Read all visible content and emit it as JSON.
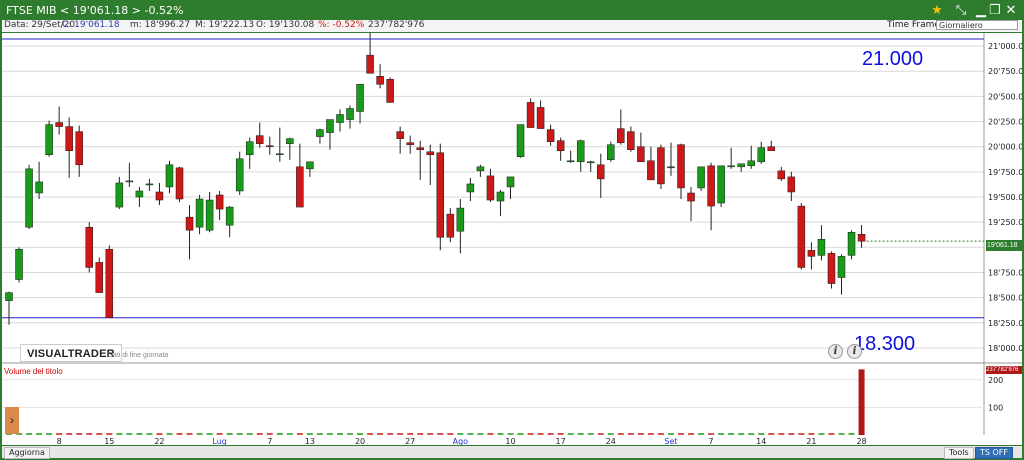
{
  "window": {
    "title": "FTSE MIB  < 19'061.18 >  -0.52%",
    "controls": [
      "star-icon",
      "pin-icon",
      "minimize-icon",
      "restore-icon",
      "close-icon"
    ]
  },
  "info": {
    "data": "Data: 29/Set/20",
    "close": "C: 19'061.18",
    "min": "m: 18'996.27",
    "max": "M: 19'222.13",
    "open": "O: 19'130.08",
    "pct": "%: -0.52%",
    "volume": "237'782'976",
    "timeframe_label": "Time Frame",
    "timeframe_value": "Giornaliero"
  },
  "annotations": {
    "level_top": "21.000",
    "level_bottom": "18.300",
    "logo": "VISUALTRADER",
    "logo_sub": "Dati di fine giornata",
    "volume_label": "Volume del titolo",
    "price_badge": "19'061.18",
    "vol_badge": "237'782'976"
  },
  "bottom": {
    "update_label": "Aggiorna",
    "tools_label": "Tools",
    "tsoff_label": "TS OFF"
  },
  "colors": {
    "up": "#1a9a1a",
    "down": "#cc1818",
    "level_line": "#2020cc",
    "volume_bar": "#b01818",
    "frame": "#2e7d2e"
  },
  "chart_data": {
    "type": "candlestick",
    "y_ticks": [
      "21'000.00",
      "20'750.00",
      "20'500.00",
      "20'250.00",
      "20'000.00",
      "19'750.00",
      "19'500.00",
      "19'250.00",
      "19'000.00",
      "18'750.00",
      "18'500.00",
      "18'250.00",
      "18'000.00"
    ],
    "ylim": [
      17900,
      21130
    ],
    "h_lines": [
      21070,
      18300
    ],
    "x_labels": [
      "8",
      "15",
      "22",
      "Lug",
      "7",
      "13",
      "20",
      "27",
      "Ago",
      "10",
      "17",
      "24",
      "Set",
      "7",
      "14",
      "21",
      "28"
    ],
    "x_label_bar_index": [
      5,
      10,
      15,
      21,
      26,
      30,
      35,
      40,
      45,
      50,
      55,
      60,
      66,
      70,
      75,
      80,
      85
    ],
    "month_labels": [
      "Lug",
      "Ago",
      "Set"
    ],
    "volume": {
      "y_ticks": [
        "200",
        "100"
      ],
      "ylim": [
        0,
        250
      ],
      "last_value": 237.78,
      "previous_values": "not shown"
    },
    "candles": [
      [
        18470,
        18560,
        18230,
        18550
      ],
      [
        18680,
        19000,
        18650,
        18980
      ],
      [
        19200,
        19820,
        19180,
        19780
      ],
      [
        19540,
        19850,
        19480,
        19650
      ],
      [
        19920,
        20260,
        19900,
        20220
      ],
      [
        20240,
        20400,
        20120,
        20200
      ],
      [
        20200,
        20290,
        19690,
        19960
      ],
      [
        20150,
        20210,
        19700,
        19820
      ],
      [
        19200,
        19250,
        18750,
        18800
      ],
      [
        18850,
        18900,
        18550,
        18550
      ],
      [
        18980,
        19020,
        18300,
        18300
      ],
      [
        19400,
        19700,
        19380,
        19640
      ],
      [
        19650,
        19840,
        19600,
        19660
      ],
      [
        19500,
        19600,
        19400,
        19560
      ],
      [
        19620,
        19680,
        19560,
        19630
      ],
      [
        19550,
        19640,
        19420,
        19470
      ],
      [
        19600,
        19860,
        19540,
        19820
      ],
      [
        19790,
        19800,
        19450,
        19480
      ],
      [
        19300,
        19420,
        18880,
        19170
      ],
      [
        19200,
        19520,
        19130,
        19480
      ],
      [
        19170,
        19550,
        19150,
        19470
      ],
      [
        19520,
        19560,
        19270,
        19380
      ],
      [
        19220,
        19410,
        19100,
        19400
      ],
      [
        19560,
        19950,
        19520,
        19880
      ],
      [
        19920,
        20090,
        19780,
        20050
      ],
      [
        20110,
        20240,
        19990,
        20030
      ],
      [
        20010,
        20100,
        19920,
        20000
      ],
      [
        19920,
        20190,
        19850,
        19930
      ],
      [
        20030,
        20090,
        19870,
        20080
      ],
      [
        19800,
        20030,
        19750,
        19400
      ],
      [
        19780,
        19830,
        19700,
        19850
      ],
      [
        20100,
        20180,
        20030,
        20170
      ],
      [
        20140,
        20270,
        19970,
        20270
      ],
      [
        20240,
        20370,
        20150,
        20320
      ],
      [
        20270,
        20410,
        20180,
        20380
      ],
      [
        20350,
        20620,
        20230,
        20620
      ],
      [
        20910,
        21130,
        20800,
        20730
      ],
      [
        20700,
        20820,
        20580,
        20620
      ],
      [
        20670,
        20690,
        20470,
        20440
      ],
      [
        20150,
        20200,
        19930,
        20080
      ],
      [
        20040,
        20110,
        19930,
        20020
      ],
      [
        19990,
        20060,
        19670,
        19970
      ],
      [
        19950,
        20020,
        19620,
        19920
      ],
      [
        19940,
        20030,
        18970,
        19100
      ],
      [
        19330,
        19390,
        19050,
        19100
      ],
      [
        19160,
        19480,
        18940,
        19390
      ],
      [
        19550,
        19690,
        19460,
        19630
      ],
      [
        19760,
        19820,
        19700,
        19800
      ],
      [
        19710,
        19780,
        19450,
        19470
      ],
      [
        19460,
        19570,
        19310,
        19550
      ],
      [
        19600,
        19700,
        19480,
        19700
      ],
      [
        19900,
        20220,
        19890,
        20220
      ],
      [
        20440,
        20480,
        20220,
        20190
      ],
      [
        20390,
        20460,
        20240,
        20180
      ],
      [
        20170,
        20220,
        20010,
        20050
      ],
      [
        20060,
        20090,
        19860,
        19960
      ],
      [
        19850,
        19960,
        19840,
        19860
      ],
      [
        19850,
        20070,
        19750,
        20060
      ],
      [
        19840,
        19860,
        19750,
        19850
      ],
      [
        19820,
        19930,
        19490,
        19680
      ],
      [
        19870,
        20050,
        19850,
        20020
      ],
      [
        20180,
        20370,
        20020,
        20040
      ],
      [
        20150,
        20200,
        19950,
        19970
      ],
      [
        20000,
        20140,
        19850,
        19850
      ],
      [
        19860,
        20000,
        19680,
        19670
      ],
      [
        19990,
        20020,
        19580,
        19630
      ],
      [
        19800,
        20040,
        19710,
        19800
      ],
      [
        20020,
        20030,
        19480,
        19590
      ],
      [
        19540,
        19600,
        19260,
        19460
      ],
      [
        19590,
        19790,
        19560,
        19800
      ],
      [
        19810,
        19840,
        19170,
        19410
      ],
      [
        19440,
        19780,
        19400,
        19810
      ],
      [
        19800,
        19990,
        19780,
        19810
      ],
      [
        19800,
        19830,
        19750,
        19830
      ],
      [
        19810,
        20010,
        19780,
        19860
      ],
      [
        19850,
        20050,
        19830,
        19990
      ],
      [
        20000,
        20060,
        19990,
        19960
      ],
      [
        19760,
        19800,
        19660,
        19680
      ],
      [
        19700,
        19750,
        19460,
        19550
      ],
      [
        19410,
        19440,
        18780,
        18800
      ],
      [
        18970,
        19050,
        18780,
        18910
      ],
      [
        18920,
        19220,
        18870,
        19080
      ],
      [
        18940,
        18960,
        18590,
        18640
      ],
      [
        18700,
        18930,
        18530,
        18910
      ],
      [
        18920,
        19170,
        18880,
        19150
      ],
      [
        19130,
        19222,
        18996,
        19061
      ]
    ]
  }
}
